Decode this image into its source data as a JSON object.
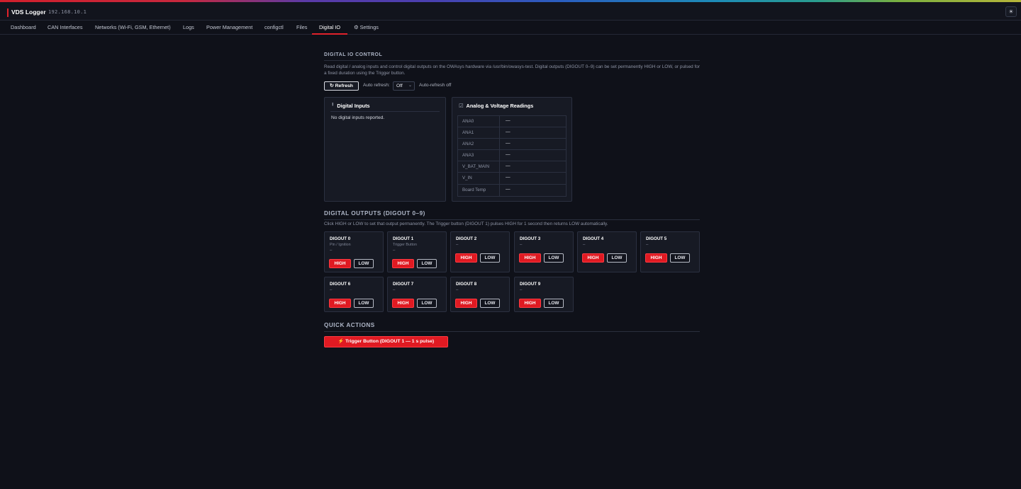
{
  "app": {
    "title": "VDS Logger",
    "ip": "192.168.10.1",
    "theme_icon": "sun-icon",
    "theme_glyph": "☀"
  },
  "nav": {
    "items": [
      "Dashboard",
      "CAN Interfaces",
      "Networks (Wi-Fi, GSM, Ethernet)",
      "Logs",
      "Power Management",
      "configctl",
      "Files",
      "Digital IO",
      "⚙ Settings"
    ],
    "active": "Digital IO"
  },
  "control": {
    "title": "DIGITAL IO CONTROL",
    "description": "Read digital / analog inputs and control digital outputs on the OWAsys hardware via /usr/bin/owasys-test. Digital outputs (DIGOUT 0–9) can be set permanently HIGH or LOW, or pulsed for a fixed duration using the Trigger button.",
    "refresh_label": "↻ Refresh",
    "auto_refresh_label": "Auto refresh:",
    "auto_refresh_value": "Off",
    "auto_refresh_status": "Auto-refresh off"
  },
  "digital_inputs": {
    "icon": "pin-icon",
    "icon_glyph": "╹",
    "title": "Digital Inputs",
    "empty": "No digital inputs reported."
  },
  "analog": {
    "icon": "checkbox-icon",
    "icon_glyph": "☑",
    "title": "Analog & Voltage Readings",
    "rows": [
      {
        "label": "ANA0",
        "value": "—"
      },
      {
        "label": "ANA1",
        "value": "—"
      },
      {
        "label": "ANA2",
        "value": "—"
      },
      {
        "label": "ANA3",
        "value": "—"
      },
      {
        "label": "V_BAT_MAIN",
        "value": "—"
      },
      {
        "label": "V_IN",
        "value": "—"
      },
      {
        "label": "Board Temp",
        "value": "—"
      }
    ]
  },
  "outputs": {
    "title": "DIGITAL OUTPUTS (DIGOUT 0–9)",
    "description": "Click HIGH or LOW to set that output permanently. The Trigger button (DIGOUT 1) pulses HIGH for 1 second then returns LOW automatically.",
    "high_label": "HIGH",
    "low_label": "LOW",
    "cards": [
      {
        "name": "DIGOUT 0",
        "sub": "Pin / Ignition",
        "state": "–"
      },
      {
        "name": "DIGOUT 1",
        "sub": "Trigger Button",
        "state": "–"
      },
      {
        "name": "DIGOUT 2",
        "sub": "",
        "state": "–"
      },
      {
        "name": "DIGOUT 3",
        "sub": "",
        "state": "–"
      },
      {
        "name": "DIGOUT 4",
        "sub": "",
        "state": "–"
      },
      {
        "name": "DIGOUT 5",
        "sub": "",
        "state": "–"
      },
      {
        "name": "DIGOUT 6",
        "sub": "",
        "state": "–"
      },
      {
        "name": "DIGOUT 7",
        "sub": "",
        "state": "–"
      },
      {
        "name": "DIGOUT 8",
        "sub": "",
        "state": "–"
      },
      {
        "name": "DIGOUT 9",
        "sub": "",
        "state": "–"
      }
    ]
  },
  "quick_actions": {
    "title": "QUICK ACTIONS",
    "trigger_label": "⚡ Trigger Button (DIGOUT 1 — 1 s pulse)"
  },
  "colors": {
    "accent": "#e01a22",
    "background": "#0f1119",
    "panel": "#171a24"
  }
}
